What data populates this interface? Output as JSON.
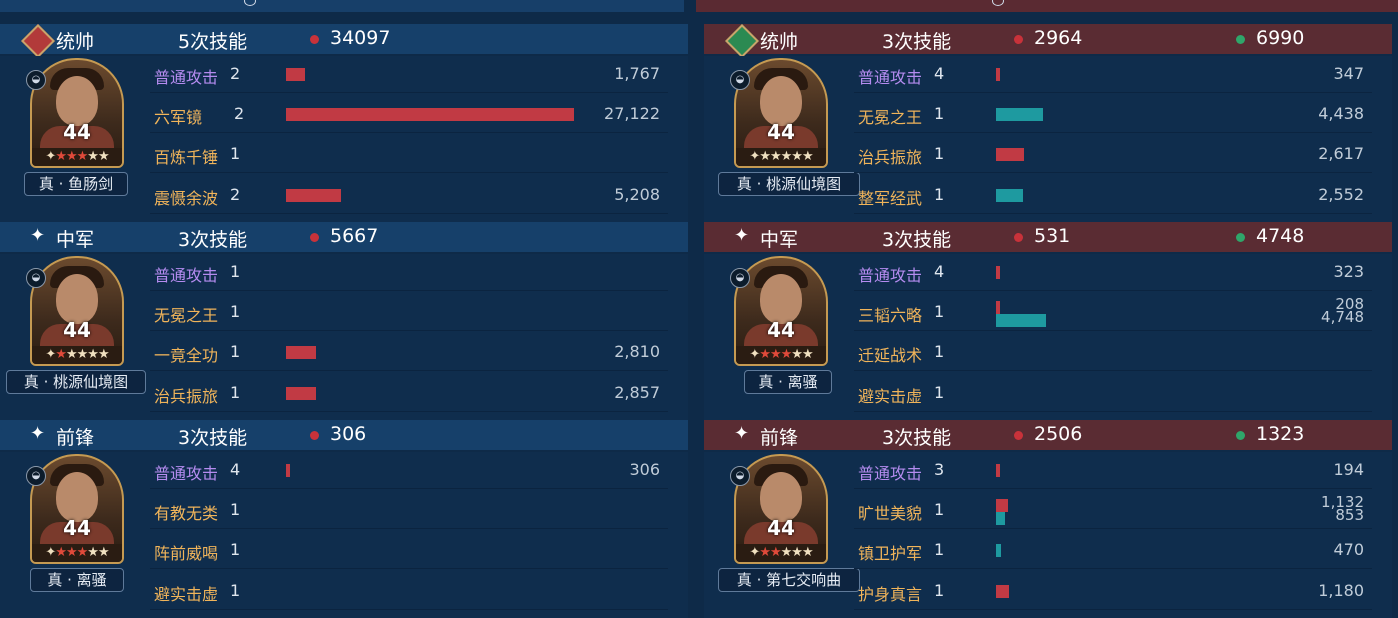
{
  "colors": {
    "damage": "#c13a44",
    "heal": "#1e9aa0",
    "skill_name": "#f0b45a",
    "normal_attack": "#b58cf0"
  },
  "left": {
    "sections": [
      {
        "role": "统帅",
        "role_icon": "sword-diamond-icon",
        "skill_count": "5次技能",
        "damage_total": "34097",
        "level": "44",
        "stars_red": 3,
        "stars_total": 5,
        "treasure": "真 · 鱼肠剑",
        "skills": [
          {
            "name": "普通攻击",
            "lvl": "2",
            "damage": 1767,
            "value": "1,767",
            "normal": true
          },
          {
            "name": "六军镜",
            "lvl": "2",
            "damage": 27122,
            "value": "27,122"
          },
          {
            "name": "百炼千锤",
            "lvl": "1"
          },
          {
            "name": "震慑余波",
            "lvl": "2",
            "damage": 5208,
            "value": "5,208"
          }
        ]
      },
      {
        "role": "中军",
        "role_icon": "sparkle-icon",
        "skill_count": "3次技能",
        "damage_total": "5667",
        "level": "44",
        "stars_red": 1,
        "stars_total": 5,
        "treasure": "真 · 桃源仙境图",
        "skills": [
          {
            "name": "普通攻击",
            "lvl": "1",
            "normal": true
          },
          {
            "name": "无冕之王",
            "lvl": "1"
          },
          {
            "name": "一竟全功",
            "lvl": "1",
            "damage": 2810,
            "value": "2,810"
          },
          {
            "name": "治兵振旅",
            "lvl": "1",
            "damage": 2857,
            "value": "2,857"
          }
        ]
      },
      {
        "role": "前锋",
        "role_icon": "sparkle-icon",
        "skill_count": "3次技能",
        "damage_total": "306",
        "level": "44",
        "stars_red": 3,
        "stars_total": 5,
        "treasure": "真 · 离骚",
        "skills": [
          {
            "name": "普通攻击",
            "lvl": "4",
            "damage": 306,
            "value": "306",
            "normal": true
          },
          {
            "name": "有教无类",
            "lvl": "1"
          },
          {
            "name": "阵前威喝",
            "lvl": "1"
          },
          {
            "name": "避实击虚",
            "lvl": "1"
          }
        ]
      }
    ]
  },
  "right": {
    "sections": [
      {
        "role": "统帅",
        "role_icon": "heart-diamond-icon",
        "skill_count": "3次技能",
        "damage_total": "2964",
        "heal_total": "6990",
        "level": "44",
        "stars_red": 0,
        "stars_total": 5,
        "treasure": "真 · 桃源仙境图",
        "skills": [
          {
            "name": "普通攻击",
            "lvl": "4",
            "damage": 347,
            "value": "347",
            "normal": true
          },
          {
            "name": "无冕之王",
            "lvl": "1",
            "heal": 4438,
            "value": "4,438"
          },
          {
            "name": "治兵振旅",
            "lvl": "1",
            "damage": 2617,
            "value": "2,617"
          },
          {
            "name": "整军经武",
            "lvl": "1",
            "heal": 2552,
            "value": "2,552"
          }
        ]
      },
      {
        "role": "中军",
        "role_icon": "sparkle-icon",
        "skill_count": "3次技能",
        "damage_total": "531",
        "heal_total": "4748",
        "level": "44",
        "stars_red": 3,
        "stars_total": 5,
        "treasure": "真 · 离骚",
        "skills": [
          {
            "name": "普通攻击",
            "lvl": "4",
            "damage": 323,
            "value": "323",
            "normal": true
          },
          {
            "name": "三韬六略",
            "lvl": "1",
            "damage": 208,
            "heal": 4748,
            "value": "208",
            "value2": "4,748"
          },
          {
            "name": "迁延战术",
            "lvl": "1"
          },
          {
            "name": "避实击虚",
            "lvl": "1"
          }
        ]
      },
      {
        "role": "前锋",
        "role_icon": "sparkle-icon",
        "skill_count": "3次技能",
        "damage_total": "2506",
        "heal_total": "1323",
        "level": "44",
        "stars_red": 2,
        "stars_total": 5,
        "treasure": "真 · 第七交响曲",
        "skills": [
          {
            "name": "普通攻击",
            "lvl": "3",
            "damage": 194,
            "value": "194",
            "normal": true
          },
          {
            "name": "旷世美貌",
            "lvl": "1",
            "damage": 1132,
            "heal": 853,
            "value": "1,132",
            "value2": "853"
          },
          {
            "name": "镇卫护军",
            "lvl": "1",
            "heal": 470,
            "value": "470"
          },
          {
            "name": "护身真言",
            "lvl": "1",
            "damage": 1180,
            "value": "1,180"
          }
        ]
      }
    ]
  }
}
